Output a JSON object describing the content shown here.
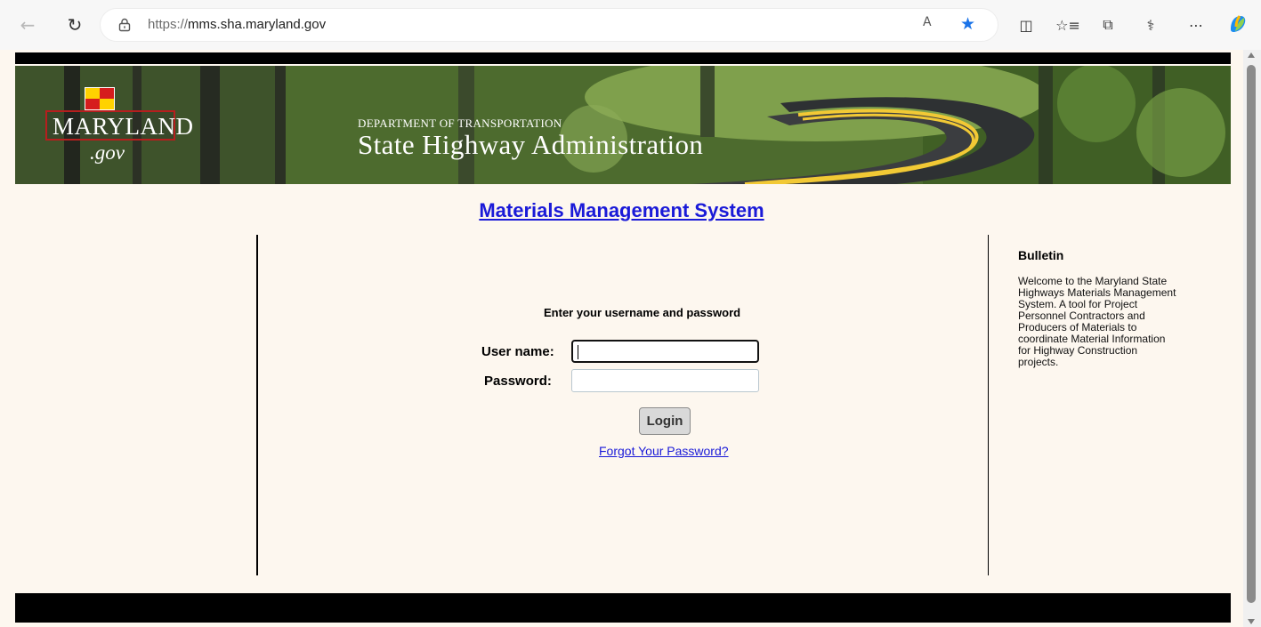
{
  "browser": {
    "url_scheme": "https://",
    "url_host": "mms.sha.maryland.gov",
    "icons": [
      "back-icon",
      "refresh-icon",
      "lock-icon",
      "read-aloud-icon",
      "favorite-star-icon",
      "split-screen-icon",
      "favorites-list-icon",
      "collections-icon",
      "health-icon",
      "more-icon",
      "copilot-icon"
    ],
    "read_aloud_label": "A",
    "favorite_star": "★",
    "split_screen": "◫",
    "favorites_list": "☆≡",
    "collections": "⧉",
    "health": "⚕",
    "more": "⋯"
  },
  "banner": {
    "logo_text": "MARYLAND",
    "logo_suffix": ".gov",
    "department": "DEPARTMENT OF TRANSPORTATION",
    "agency": "State Highway Administration"
  },
  "page": {
    "title": "Materials Management System"
  },
  "login": {
    "heading": "Enter your username and password",
    "username_label": "User name:",
    "password_label": "Password:",
    "username_value": "",
    "password_value": "",
    "button_label": "Login",
    "forgot_link": "Forgot Your Password?"
  },
  "bulletin": {
    "title": "Bulletin",
    "body": "Welcome to the Maryland State Highways Materials Management System. A tool for Project Personnel Contractors and Producers of Materials to coordinate Material Information for Highway Construction projects."
  },
  "colors": {
    "page_background": "#fdf7ef",
    "link_blue": "#1a1ad8",
    "browser_star": "#1a73e8"
  }
}
